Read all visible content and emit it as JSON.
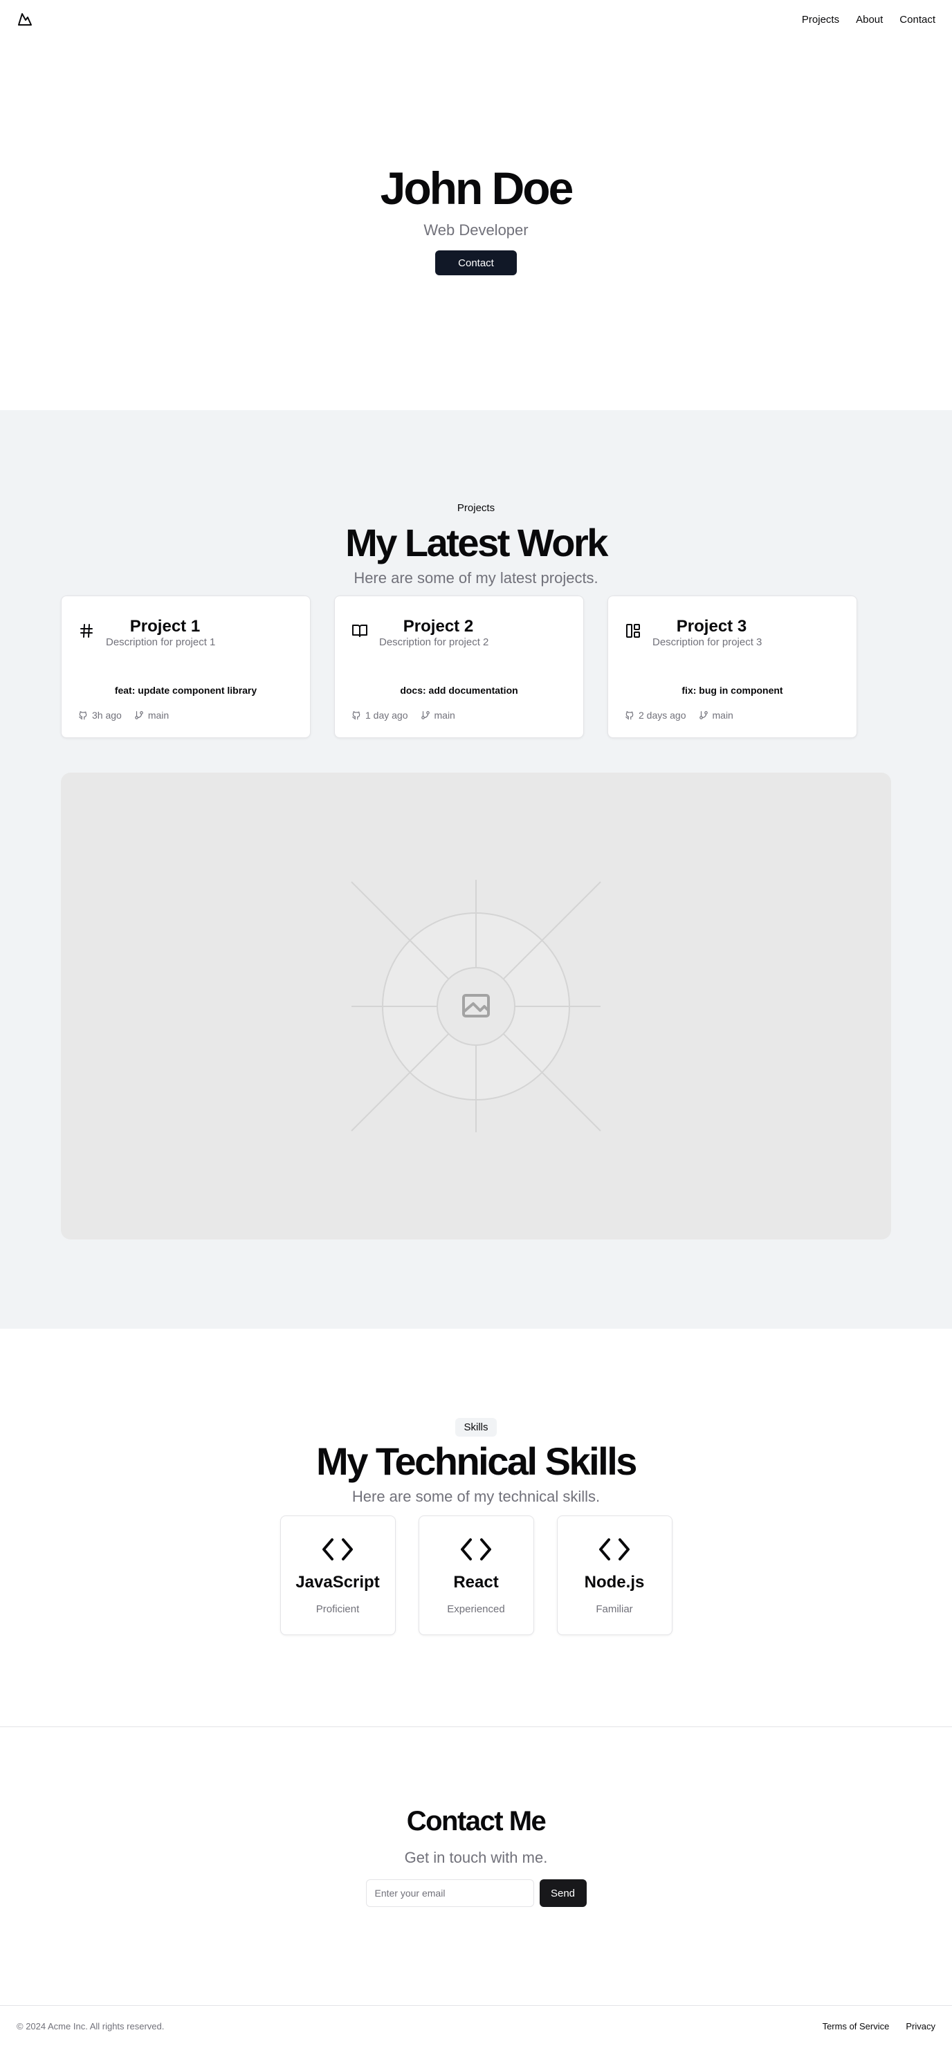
{
  "nav": {
    "links": [
      "Projects",
      "About",
      "Contact"
    ]
  },
  "hero": {
    "name": "John Doe",
    "role": "Web Developer",
    "cta": "Contact"
  },
  "projects": {
    "tag": "Projects",
    "title": "My Latest Work",
    "subtitle": "Here are some of my latest projects.",
    "items": [
      {
        "icon": "hash-icon",
        "title": "Project 1",
        "description": "Description for project 1",
        "commit": "feat: update component library",
        "time": "3h ago",
        "branch": "main"
      },
      {
        "icon": "book-open-icon",
        "title": "Project 2",
        "description": "Description for project 2",
        "commit": "docs: add documentation",
        "time": "1 day ago",
        "branch": "main"
      },
      {
        "icon": "layout-icon",
        "title": "Project 3",
        "description": "Description for project 3",
        "commit": "fix: bug in component",
        "time": "2 days ago",
        "branch": "main"
      }
    ]
  },
  "skills": {
    "tag": "Skills",
    "title": "My Technical Skills",
    "subtitle": "Here are some of my technical skills.",
    "items": [
      {
        "icon": "code-icon",
        "name": "JavaScript",
        "level": "Proficient"
      },
      {
        "icon": "code-icon",
        "name": "React",
        "level": "Experienced"
      },
      {
        "icon": "code-icon",
        "name": "Node.js",
        "level": "Familiar"
      }
    ]
  },
  "contact": {
    "title": "Contact Me",
    "subtitle": "Get in touch with me.",
    "email_placeholder": "Enter your email",
    "send": "Send"
  },
  "footer": {
    "copyright": "© 2024 Acme Inc. All rights reserved.",
    "links": [
      "Terms of Service",
      "Privacy"
    ]
  },
  "colors": {
    "primary_button": "#111827",
    "section_bg": "#f1f3f5",
    "muted_text": "#71717a"
  }
}
